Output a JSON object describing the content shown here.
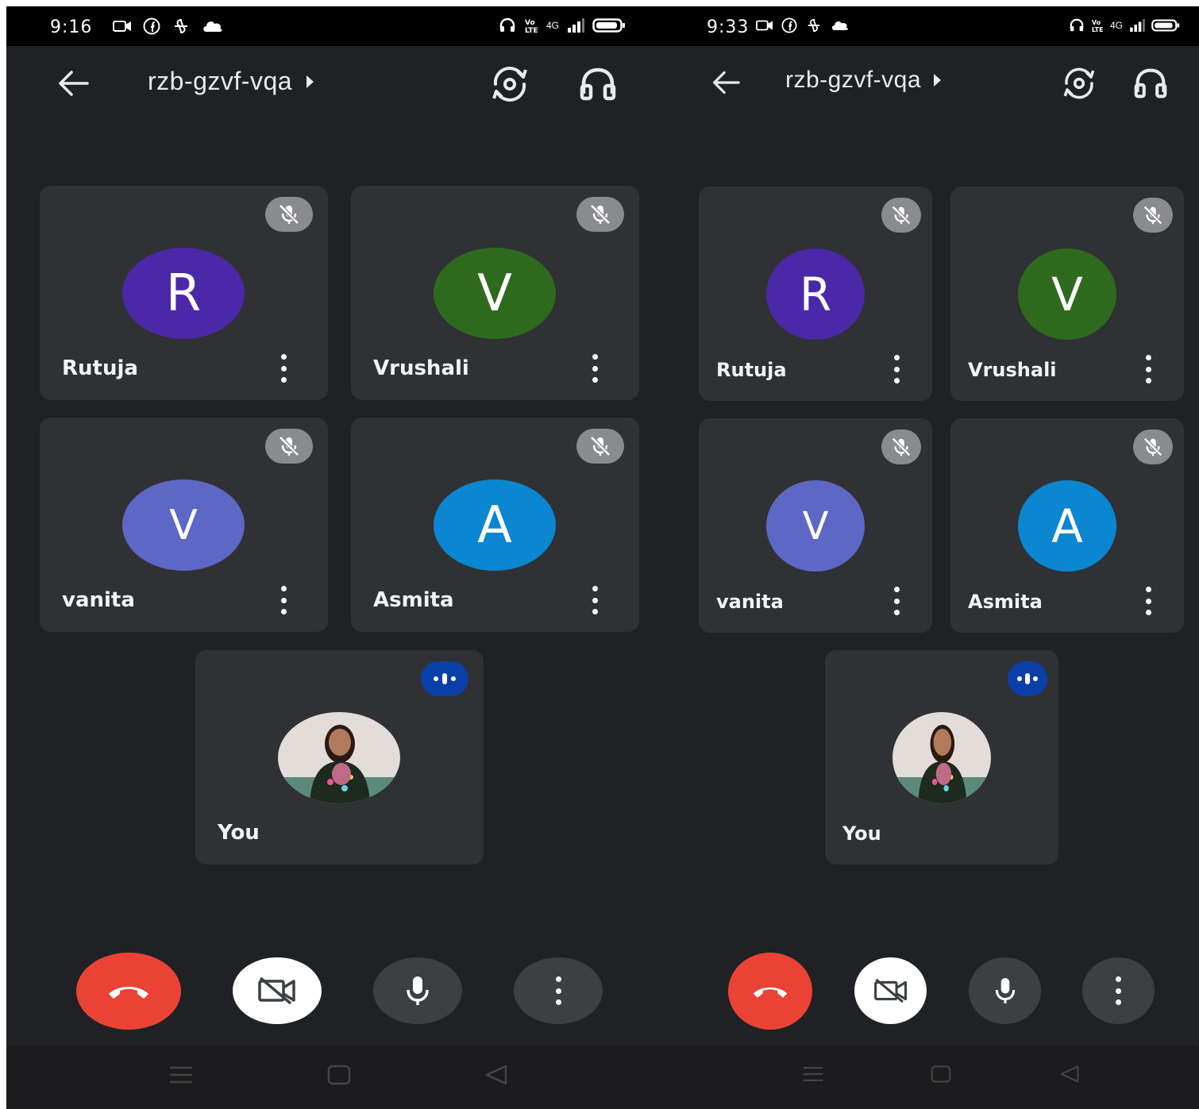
{
  "screens": [
    {
      "status": {
        "time": "9:16",
        "net": "4G"
      },
      "meeting_code": "rzb-gzvf-vqa",
      "participants": [
        {
          "name": "Rutuja",
          "initial": "R",
          "color": "#4b28a8",
          "muted": true
        },
        {
          "name": "Vrushali",
          "initial": "V",
          "color": "#2e6a1e",
          "muted": true
        },
        {
          "name": "vanita",
          "initial": "V",
          "color": "#5c67c6",
          "muted": true
        },
        {
          "name": "Asmita",
          "initial": "A",
          "color": "#0b86d0",
          "muted": true
        }
      ],
      "self": {
        "name": "You",
        "speaking": true
      }
    },
    {
      "status": {
        "time": "9:33",
        "net": "4G"
      },
      "meeting_code": "rzb-gzvf-vqa",
      "participants": [
        {
          "name": "Rutuja",
          "initial": "R",
          "color": "#4b28a8",
          "muted": true
        },
        {
          "name": "Vrushali",
          "initial": "V",
          "color": "#2e6a1e",
          "muted": true
        },
        {
          "name": "vanita",
          "initial": "V",
          "color": "#5c67c6",
          "muted": true
        },
        {
          "name": "Asmita",
          "initial": "A",
          "color": "#0b86d0",
          "muted": true
        }
      ],
      "self": {
        "name": "You",
        "speaking": true
      }
    }
  ],
  "controls": {
    "icons": [
      "end-call-icon",
      "camera-off-icon",
      "microphone-icon",
      "more-options-icon"
    ],
    "colors": {
      "end_call": "#ea4335",
      "camera_off": "#ffffff",
      "neutral": "#3c4043"
    }
  },
  "theme": {
    "background": "#202124",
    "tile": "#303134",
    "speaking_badge": "#0b3fa8"
  }
}
